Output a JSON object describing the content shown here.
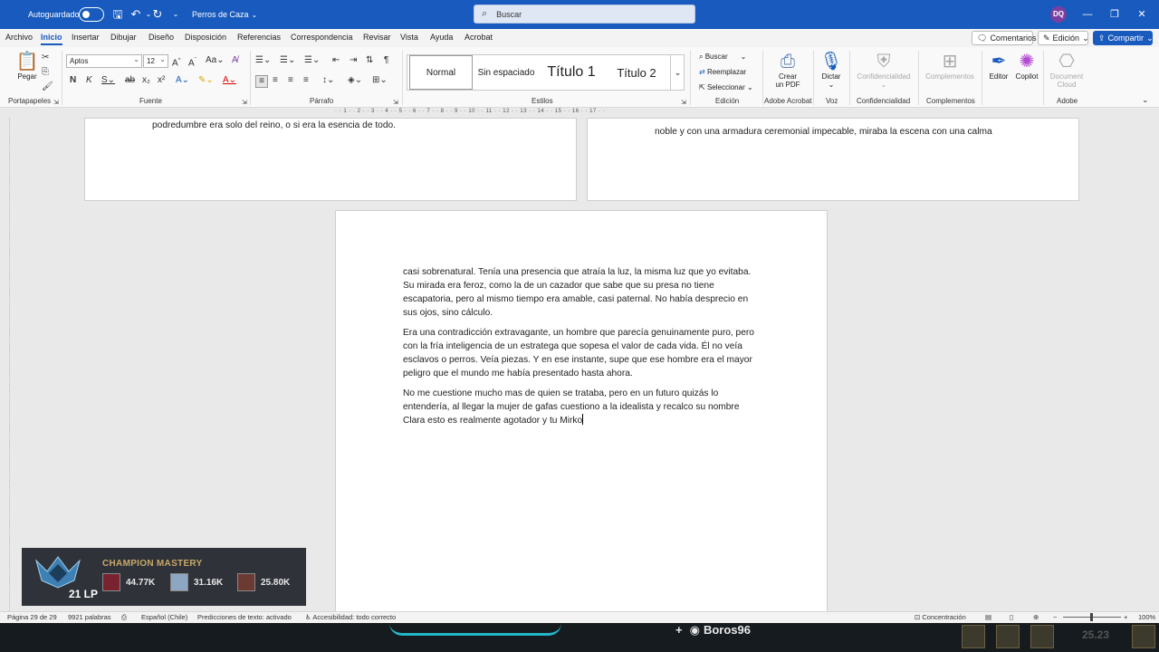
{
  "titlebar": {
    "autosave_label": "Autoguardado",
    "doc_title": "Perros de Caza",
    "search_placeholder": "Buscar",
    "user_initials": "DQ"
  },
  "menu": {
    "tabs": [
      "Archivo",
      "Inicio",
      "Insertar",
      "Dibujar",
      "Diseño",
      "Disposición",
      "Referencias",
      "Correspondencia",
      "Revisar",
      "Vista",
      "Ayuda",
      "Acrobat"
    ],
    "active_tab": "Inicio",
    "comments_label": "Comentarios",
    "edit_mode_label": "Edición",
    "share_label": "Compartir"
  },
  "ribbon": {
    "clipboard": {
      "paste_label": "Pegar",
      "group_label": "Portapapeles"
    },
    "font": {
      "family": "Aptos",
      "size": "12",
      "group_label": "Fuente"
    },
    "paragraph": {
      "group_label": "Párrafo"
    },
    "styles": {
      "items": [
        "Normal",
        "Sin espaciado",
        "Título 1",
        "Título 2"
      ],
      "group_label": "Estilos"
    },
    "editing": {
      "find_label": "Buscar",
      "replace_label": "Reemplazar",
      "select_label": "Seleccionar",
      "group_label": "Edición"
    },
    "acrobat": {
      "create_pdf_line1": "Crear",
      "create_pdf_line2": "un PDF",
      "group_label": "Adobe Acrobat"
    },
    "voice": {
      "dictate_label": "Dictar",
      "group_label": "Voz"
    },
    "sensitivity": {
      "label": "Confidencialidad",
      "group_label": "Confidencialidad"
    },
    "addins": {
      "label": "Complementos",
      "group_label": "Complementos"
    },
    "editor_label": "Editor",
    "copilot_label": "Copilot",
    "adobe": {
      "doc_cloud_line1": "Document",
      "doc_cloud_line2": "Cloud",
      "group_label": "Adobe"
    }
  },
  "ruler": {
    "numbers": "· · 1 · · 2 · · 3 · · 4 · · 5 · · 6 · · 7 · · 8 · · 9 · · 10 · · 11 · · 12 · · 13 · · 14 · · 15 · · 16 · · 17 · ·"
  },
  "pages": {
    "top_left_text": "podredumbre era solo del reino, o si era la esencia de todo.",
    "top_right_text": "noble y con una armadura ceremonial impecable, miraba la escena con una calma",
    "main_paragraphs": [
      "casi sobrenatural. Tenía una presencia que atraía la luz, la misma luz que yo evitaba. Su mirada era feroz, como la de un cazador que sabe que su presa no tiene escapatoria, pero al mismo tiempo era amable, casi paternal. No había desprecio en sus ojos, sino cálculo.",
      "Era una contradicción extravagante, un hombre que parecía genuinamente puro, pero con la fría inteligencia de un estratega que sopesa el valor de cada vida. Él no veía esclavos o perros. Veía piezas. Y en ese instante, supe que ese hombre era el mayor peligro que el mundo me había presentado hasta ahora.",
      "No me cuestione mucho mas de quien se trataba, pero en un futuro quizás lo entendería, al llegar la mujer de gafas cuestiono a la idealista y recalco su nombre Clara esto es realmente agotador y tu Mirko"
    ]
  },
  "mastery": {
    "title": "CHAMPION MASTERY",
    "lp": "21 LP",
    "champions": [
      "44.77K",
      "31.16K",
      "25.80K"
    ]
  },
  "status": {
    "page": "Página 29 de 29",
    "words": "9921 palabras",
    "language": "Español (Chile)",
    "predictions": "Predicciones de texto: activado",
    "accessibility": "Accesibilidad: todo correcto",
    "focus": "Concentración",
    "zoom": "100%"
  },
  "game": {
    "player_name": "Boros96",
    "clock": "25.23"
  }
}
